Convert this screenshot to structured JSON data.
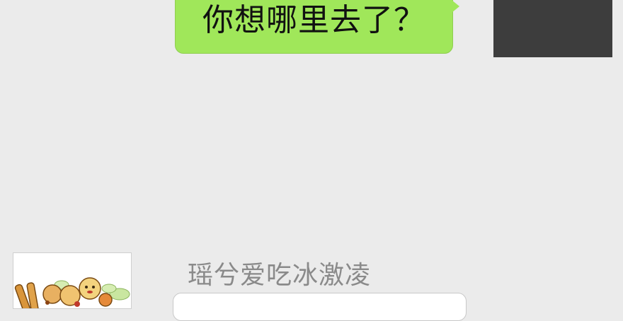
{
  "conversation": {
    "outgoing_message": {
      "text": "你想哪里去了？"
    },
    "incoming_message": {
      "sender_name": "瑶兮爱吃冰激凌",
      "text": ""
    }
  },
  "avatars": {
    "self": {
      "icon": "avatar-dark-placeholder",
      "color": "#3d3d3d"
    },
    "other": {
      "icon": "cartoon-food-avatar"
    }
  },
  "colors": {
    "background": "#ebebeb",
    "outgoing_bubble": "#a0e75a",
    "incoming_bubble": "#ffffff",
    "sender_name": "#8a8a8a"
  }
}
